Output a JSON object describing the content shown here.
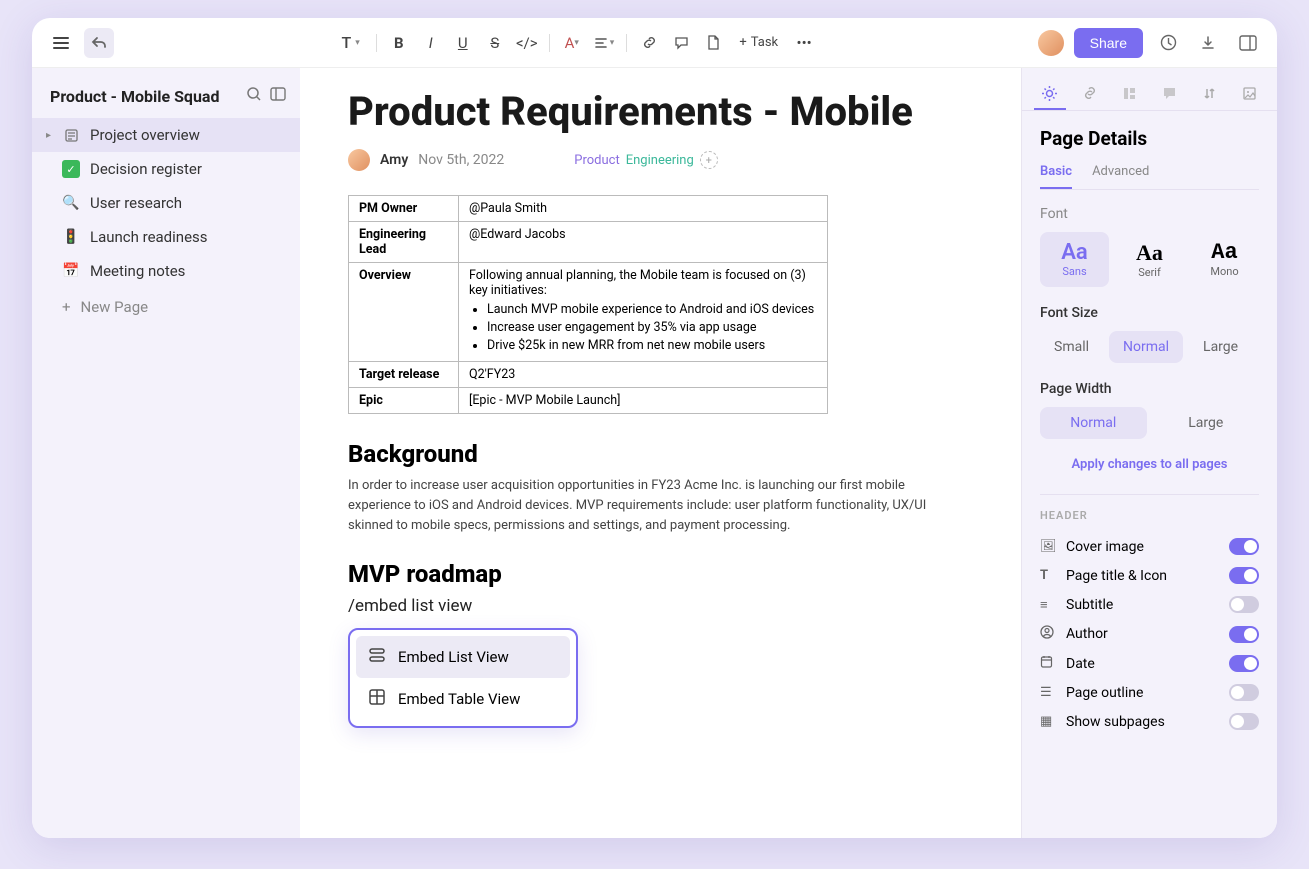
{
  "toolbar": {
    "text_label": "T",
    "task_label": "Task",
    "share_label": "Share"
  },
  "sidebar": {
    "title": "Product - Mobile Squad",
    "items": [
      {
        "icon": "📄",
        "label": "Project overview",
        "active": true,
        "hasChevron": true
      },
      {
        "icon": "✅",
        "label": "Decision register"
      },
      {
        "icon": "🔍",
        "label": "User research"
      },
      {
        "icon": "🚦",
        "label": "Launch readiness"
      },
      {
        "icon": "📅",
        "label": "Meeting notes"
      }
    ],
    "new_page": "New Page"
  },
  "doc": {
    "title": "Product Requirements - Mobile",
    "author": "Amy",
    "date": "Nov 5th, 2022",
    "tag_product": "Product",
    "tag_eng": "Engineering",
    "table": {
      "r1_k": "PM Owner",
      "r1_v": "@Paula Smith",
      "r2_k": "Engineering Lead",
      "r2_v": "@Edward Jacobs",
      "r3_k": "Overview",
      "r3_intro": "Following annual planning, the Mobile team is focused on (3) key initiatives:",
      "r3_b1": "Launch MVP mobile experience to Android and iOS devices",
      "r3_b2": "Increase user engagement by 35% via app usage",
      "r3_b3": "Drive $25k in new MRR from net new mobile users",
      "r4_k": "Target release",
      "r4_v": "Q2'FY23",
      "r5_k": "Epic",
      "r5_v": "[Epic - MVP Mobile Launch]"
    },
    "bg_h": "Background",
    "bg_p": "In order to increase user acquisition opportunities in FY23 Acme Inc. is launching our first mobile experience to iOS and Android devices. MVP requirements include: user platform functionality, UX/UI skinned to mobile specs, permissions and settings, and payment processing.",
    "mvp_h": "MVP roadmap",
    "slash": "/embed list view",
    "embed_list": "Embed List View",
    "embed_table": "Embed Table View"
  },
  "panel": {
    "title": "Page Details",
    "sub_basic": "Basic",
    "sub_advanced": "Advanced",
    "font_label": "Font",
    "font_sans": "Sans",
    "font_serif": "Serif",
    "font_mono": "Mono",
    "size_label": "Font Size",
    "size_small": "Small",
    "size_normal": "Normal",
    "size_large": "Large",
    "width_label": "Page Width",
    "width_normal": "Normal",
    "width_large": "Large",
    "apply_all": "Apply changes to all pages",
    "header_label": "HEADER",
    "toggles": [
      {
        "icon": "🖼",
        "label": "Cover image",
        "on": true
      },
      {
        "icon": "T",
        "label": "Page title & Icon",
        "on": true
      },
      {
        "icon": "≡",
        "label": "Subtitle",
        "on": false
      },
      {
        "icon": "👤",
        "label": "Author",
        "on": true
      },
      {
        "icon": "📅",
        "label": "Date",
        "on": true
      },
      {
        "icon": "☰",
        "label": "Page outline",
        "on": false
      },
      {
        "icon": "▦",
        "label": "Show subpages",
        "on": false
      }
    ]
  }
}
